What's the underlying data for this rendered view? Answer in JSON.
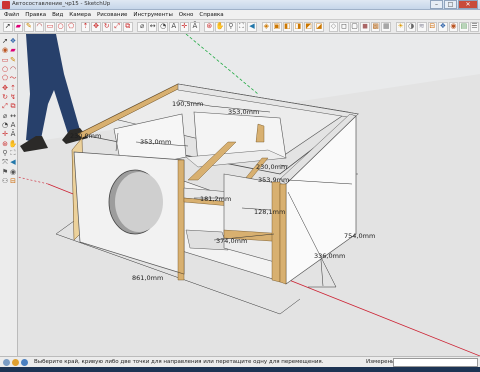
{
  "window": {
    "title": "Автосоставление_чр15 - SketchUp",
    "controls": {
      "minimize": "–",
      "maximize": "□",
      "close": "✕"
    }
  },
  "menu": [
    "Файл",
    "Правка",
    "Вид",
    "Камера",
    "Рисование",
    "Инструменты",
    "Окно",
    "Справка"
  ],
  "toolbar_icons": [
    "select-icon",
    "eraser-icon",
    "pencil-icon",
    "arc-icon",
    "rectangle-icon",
    "circle-icon",
    "polygon-icon",
    "pushpull-icon",
    "move-icon",
    "rotate-icon",
    "scale-icon",
    "offset-icon",
    "tape-icon",
    "dimension-icon",
    "protractor-icon",
    "text-icon",
    "axes-icon",
    "3dtext-icon",
    "orbit-icon",
    "pan-icon",
    "zoom-icon",
    "zoom-extents-icon",
    "previous-view-icon",
    "iso-view-icon",
    "top-view-icon",
    "front-view-icon",
    "right-view-icon",
    "back-view-icon",
    "left-view-icon",
    "xray-icon",
    "wireframe-icon",
    "hidden-line-icon",
    "shaded-icon",
    "textured-icon",
    "monochrome-icon",
    "sun-icon",
    "shadow-icon",
    "fog-icon",
    "section-icon",
    "components-icon",
    "materials-icon",
    "styles-icon",
    "layers-icon"
  ],
  "dimensions": {
    "d1": "190,5mm",
    "d2": "353,0mm",
    "d3": "230,0mm",
    "d4": "353,0mm",
    "d5": "230,0mm",
    "d6": "353,9mm",
    "d7": "181,2mm",
    "d8": "128,1mm",
    "d9": "374,0mm",
    "d10": "754,0mm",
    "d11": "336,0mm",
    "d12": "861,0mm"
  },
  "status": {
    "message": "Выберите край, кривую либо две точки для направления или перетащите одну для перемещения.",
    "measure_label": "Измерения",
    "measure_value": ""
  }
}
